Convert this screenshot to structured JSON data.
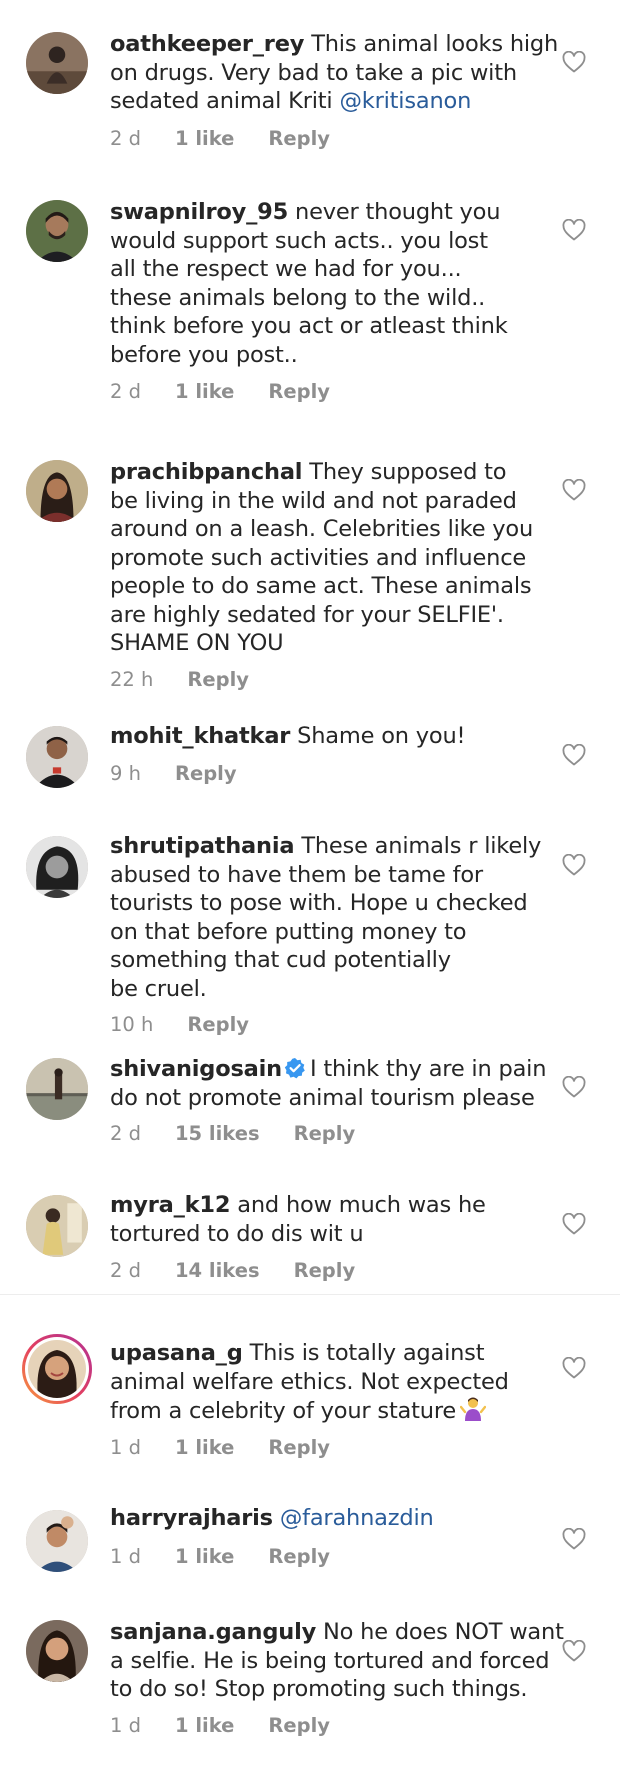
{
  "comments": [
    {
      "username": "oathkeeper_rey",
      "lines": [
        "This animal looks high",
        "on drugs. Very bad to take a pic with",
        "sedated animal Kriti "
      ],
      "mention": "@kritisanon",
      "time": "2 d",
      "likes": "1 like",
      "reply": "Reply"
    },
    {
      "username": "swapnilroy_95",
      "lines": [
        "never thought you",
        "would support such acts.. you lost",
        "all the respect we had for you...",
        "these animals belong to the wild..",
        "think before you act or atleast think",
        "before you post.."
      ],
      "time": "2 d",
      "likes": "1 like",
      "reply": "Reply"
    },
    {
      "username": "prachibpanchal",
      "lines": [
        "They supposed to",
        "be living in the wild and not paraded",
        "around on a leash. Celebrities like you",
        "promote such activities and influence",
        "people to do same act. These animals",
        "are highly sedated for your SELFIE'.",
        "SHAME ON YOU"
      ],
      "time": "22 h",
      "reply": "Reply"
    },
    {
      "username": "mohit_khatkar",
      "lines": [
        "Shame on you!"
      ],
      "time": "9 h",
      "reply": "Reply"
    },
    {
      "username": "shrutipathania",
      "lines": [
        "These animals r likely",
        "abused to have them be tame for",
        "tourists to pose with. Hope u checked",
        "on that before putting money to",
        "something that cud potentially",
        "be cruel."
      ],
      "time": "10 h",
      "reply": "Reply"
    },
    {
      "username": "shivanigosain",
      "verified": true,
      "lines": [
        "I think thy are in pain",
        "do not promote animal  tourism please"
      ],
      "time": "2 d",
      "likes": "15 likes",
      "reply": "Reply"
    },
    {
      "username": "myra_k12",
      "lines": [
        "and how much was he",
        "tortured to do dis wit u"
      ],
      "time": "2 d",
      "likes": "14 likes",
      "reply": "Reply"
    },
    {
      "username": "upasana_g",
      "lines": [
        "This is totally against",
        "animal welfare ethics. Not expected",
        "from a celebrity of your stature"
      ],
      "emoji": "person-shrugging-emoji",
      "time": "1 d",
      "likes": "1 like",
      "reply": "Reply"
    },
    {
      "username": "harryrajharis",
      "lines": [
        ""
      ],
      "mention": "@farahnazdin",
      "time": "1 d",
      "likes": "1 like",
      "reply": "Reply"
    },
    {
      "username": "sanjana.ganguly",
      "lines": [
        "No he does NOT want",
        "a selfie. He is being tortured and forced",
        "to do so! Stop promoting such things."
      ],
      "time": "1 d",
      "likes": "1 like",
      "reply": "Reply"
    }
  ],
  "icons": {
    "like": "heart-outline-icon",
    "verified": "verified-badge-icon"
  },
  "colors": {
    "text": "#262626",
    "meta": "#8e8e8e",
    "mention": "#2a5c9a",
    "verified": "#3897f0",
    "story_ring": [
      "#f9a03c",
      "#e4405f",
      "#c13584"
    ]
  }
}
